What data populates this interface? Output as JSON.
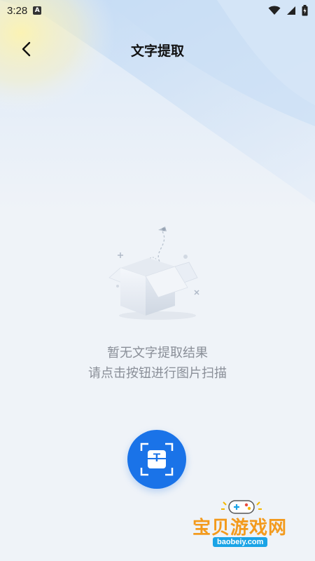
{
  "status_bar": {
    "time": "3:28",
    "notification_icon_letter": "A",
    "icons": [
      "wifi-icon",
      "signal-icon",
      "battery-icon"
    ]
  },
  "header": {
    "title": "文字提取",
    "back_icon": "chevron-left-icon"
  },
  "empty_state": {
    "illustration_icon": "open-box-icon",
    "line1": "暂无文字提取结果",
    "line2": "请点击按钮进行图片扫描"
  },
  "scan_button": {
    "icon": "text-scan-icon",
    "glyph": "T",
    "color": "#1a73e8"
  },
  "watermark": {
    "name": "宝贝游戏网",
    "domain": "baobeiy.com"
  },
  "colors": {
    "background": "#eff3f8",
    "accent": "#1a73e8",
    "empty_text": "#8a8f98"
  }
}
